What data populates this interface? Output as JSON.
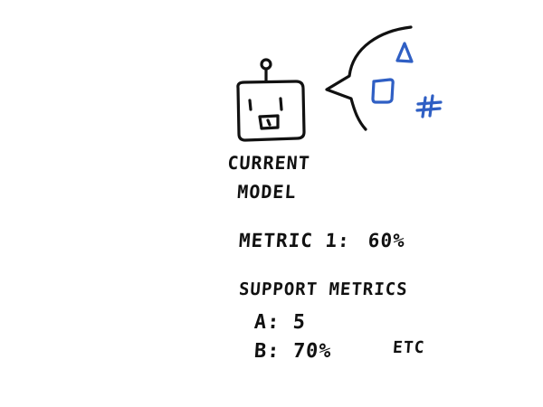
{
  "model": {
    "label_line1": "CURRENT",
    "label_line2": "MODEL"
  },
  "metrics": {
    "primary_label": "METRIC 1:",
    "primary_value": "60%",
    "support_heading": "SUPPORT METRICS",
    "items": [
      {
        "label": "A:",
        "value": "5"
      },
      {
        "label": "B:",
        "value": "70%"
      }
    ],
    "etc": "ETC"
  },
  "colors": {
    "ink": "#111111",
    "accent": "#2f5fc4"
  },
  "icons": {
    "robot": "robot-head-icon",
    "bubble": "speech-bubble-icon",
    "shapes": [
      "triangle-icon",
      "square-icon",
      "hash-icon"
    ]
  }
}
